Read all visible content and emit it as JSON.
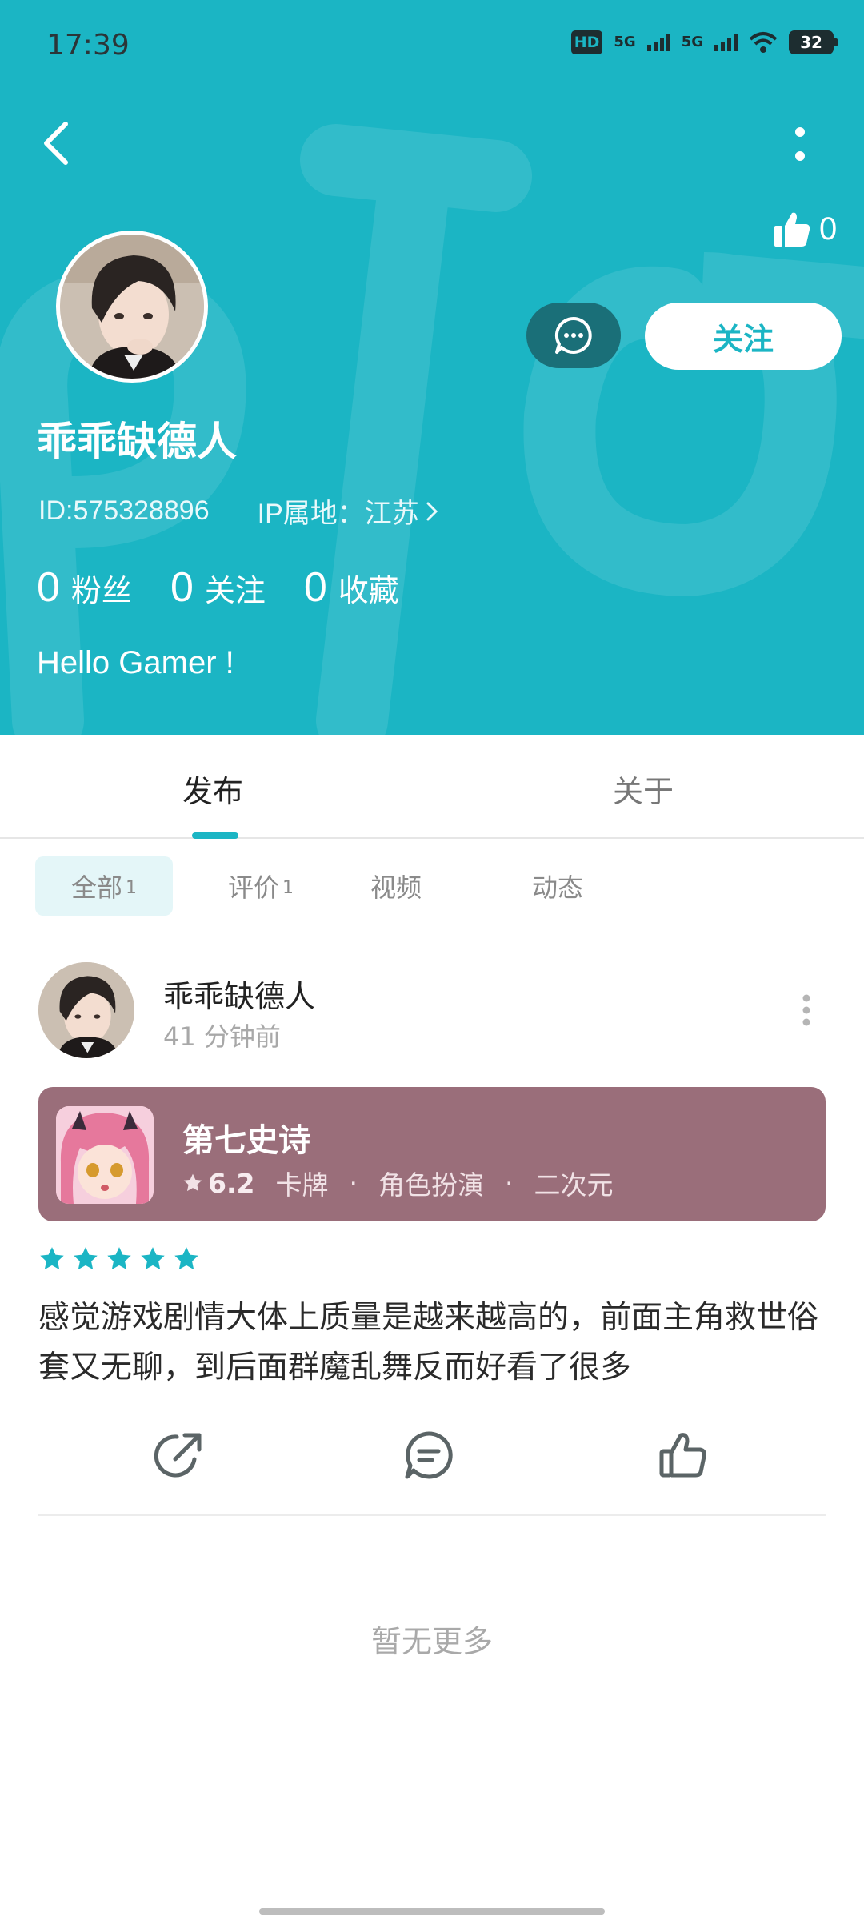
{
  "status_bar": {
    "time": "17:39",
    "hd": "HD",
    "net1": "5G",
    "net2": "5G",
    "battery": "32"
  },
  "profile": {
    "like_count": "0",
    "follow_label": "关注",
    "username": "乖乖缺德人",
    "id_text": "ID:575328896",
    "ip_text": "IP属地：江苏",
    "stats": [
      {
        "num": "0",
        "label": "粉丝"
      },
      {
        "num": "0",
        "label": "关注"
      },
      {
        "num": "0",
        "label": "收藏"
      }
    ],
    "bio": "Hello Gamer !"
  },
  "tabs": {
    "main": [
      {
        "label": "发布",
        "active": true
      },
      {
        "label": "关于",
        "active": false
      }
    ],
    "sub": [
      {
        "label": "全部",
        "count": "1",
        "active": true
      },
      {
        "label": "评价",
        "count": "1",
        "active": false
      },
      {
        "label": "视频",
        "count": "",
        "active": false
      },
      {
        "label": "动态",
        "count": "",
        "active": false
      }
    ]
  },
  "post": {
    "user": "乖乖缺德人",
    "time": "41 分钟前",
    "game": {
      "name": "第七史诗",
      "rating": "6.2",
      "tags": [
        "卡牌",
        "角色扮演",
        "二次元"
      ]
    },
    "stars": 5,
    "text": "感觉游戏剧情大体上质量是越来越高的，前面主角救世俗套又无聊，到后面群魔乱舞反而好看了很多"
  },
  "footer": {
    "no_more": "暂无更多"
  },
  "colors": {
    "accent": "#1bb5c4",
    "card": "#9a6e7a",
    "message_button": "#1a6f78"
  }
}
